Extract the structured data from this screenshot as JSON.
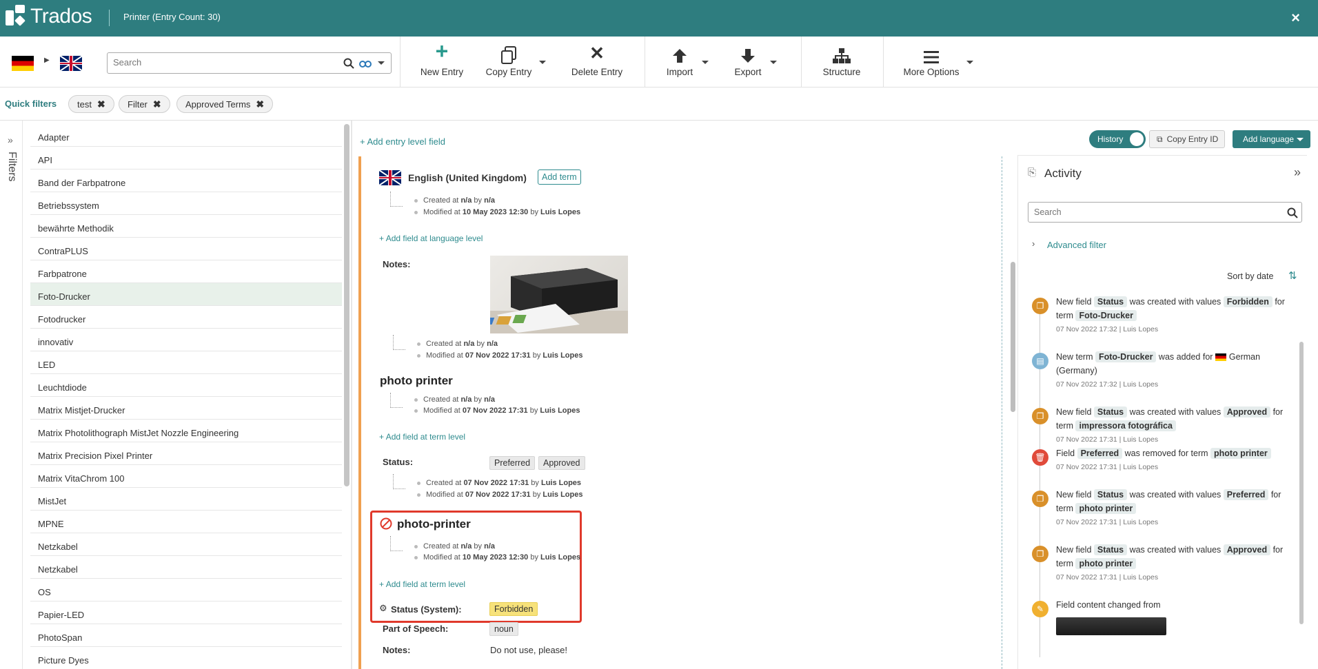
{
  "app": {
    "name": "Trados",
    "window_title": "Printer (Entry Count: 30)",
    "close": "×"
  },
  "toolbar": {
    "search_placeholder": "Search",
    "new_entry": "New Entry",
    "copy_entry": "Copy Entry",
    "delete_entry": "Delete Entry",
    "import": "Import",
    "export": "Export",
    "structure": "Structure",
    "more_options": "More Options"
  },
  "quick_filters": {
    "label": "Quick filters",
    "chips": [
      "test",
      "Filter",
      "Approved Terms"
    ]
  },
  "filters_label": "Filters",
  "entries": [
    "Adapter",
    "API",
    "Band der Farbpatrone",
    "Betriebssystem",
    "bewährte Methodik",
    "ContraPLUS",
    "Farbpatrone",
    "Foto-Drucker",
    "Fotodrucker",
    "innovativ",
    "LED",
    "Leuchtdiode",
    "Matrix Mistjet-Drucker",
    "Matrix Photolithograph MistJet Nozzle Engineering",
    "Matrix Precision Pixel Printer",
    "Matrix VitaChrom 100",
    "MistJet",
    "MPNE",
    "Netzkabel",
    "Netzkabel",
    "OS",
    "Papier-LED",
    "PhotoSpan",
    "Picture Dyes"
  ],
  "selected_entry": "Foto-Drucker",
  "entry": {
    "add_entry_field": "Add entry level field",
    "history": "History",
    "copy_entry_id": "Copy Entry ID",
    "add_language": "Add language",
    "language": "English (United Kingdom)",
    "add_term": "Add term",
    "lang_created": "Created at",
    "na": "n/a",
    "by": "by",
    "modified_at": "Modified at",
    "lang_modified_date": "10 May 2023 12:30",
    "user": "Luis Lopes",
    "add_field_language": "Add field at language level",
    "notes_label": "Notes:",
    "notes_modified_date": "07 Nov 2022 17:31",
    "term1": "photo printer",
    "term1_modified_date": "07 Nov 2022 17:31",
    "add_field_term": "Add field at term level",
    "status_label": "Status:",
    "status_values": [
      "Preferred",
      "Approved"
    ],
    "status_created_date": "07 Nov 2022 17:31",
    "status_modified_date": "07 Nov 2022 17:31",
    "term2": "photo-printer",
    "term2_modified_date": "10 May 2023 12:30",
    "status_system_label": "Status (System):",
    "status_system_value": "Forbidden",
    "pos_label": "Part of Speech:",
    "pos_value": "noun",
    "notes2_label": "Notes:",
    "notes2_value": "Do not use, please!"
  },
  "activity": {
    "title": "Activity",
    "search_placeholder": "Search",
    "advanced_filter": "Advanced filter",
    "sort": "Sort by date",
    "items": [
      {
        "icon": "status-icon",
        "color": "#d9902a",
        "parts": [
          "New field ",
          "Status",
          " was created with values ",
          "Forbidden",
          " for term ",
          "Foto-Drucker"
        ],
        "when": "07 Nov 2022 17:32 | Luis Lopes"
      },
      {
        "icon": "book-icon",
        "color": "#7fb4d4",
        "parts": [
          "New term ",
          "Foto-Drucker",
          " was added for ",
          "",
          "German (Germany)",
          ""
        ],
        "when": "07 Nov 2022 17:32 | Luis Lopes"
      },
      {
        "icon": "status-icon",
        "color": "#d9902a",
        "parts": [
          "New field ",
          "Status",
          " was created with values ",
          "Approved",
          " for term ",
          "impressora fotográfica"
        ],
        "when": "07 Nov 2022 17:31 | Luis Lopes"
      },
      {
        "icon": "trash-icon",
        "color": "#e04a3a",
        "parts": [
          "Field ",
          "Preferred",
          " was removed for term ",
          "photo printer",
          "",
          ""
        ],
        "when": "07 Nov 2022 17:31 | Luis Lopes"
      },
      {
        "icon": "status-icon",
        "color": "#d9902a",
        "parts": [
          "New field ",
          "Status",
          " was created with values ",
          "Preferred",
          " for term ",
          "photo printer"
        ],
        "when": "07 Nov 2022 17:31 | Luis Lopes"
      },
      {
        "icon": "status-icon",
        "color": "#d9902a",
        "parts": [
          "New field ",
          "Status",
          " was created with values ",
          "Approved",
          " for term ",
          "photo printer"
        ],
        "when": "07 Nov 2022 17:31 | Luis Lopes"
      },
      {
        "icon": "pencil-icon",
        "color": "#f0b030",
        "parts": [
          "Field content changed from",
          "",
          "",
          "",
          "",
          ""
        ],
        "when": ""
      }
    ]
  },
  "colors": {
    "header": "#2e7d7f",
    "accent": "#2e8b8e",
    "forbidden": "#f7e27a",
    "highlight_border": "#e0392b",
    "entry_bar": "#f0a050"
  }
}
